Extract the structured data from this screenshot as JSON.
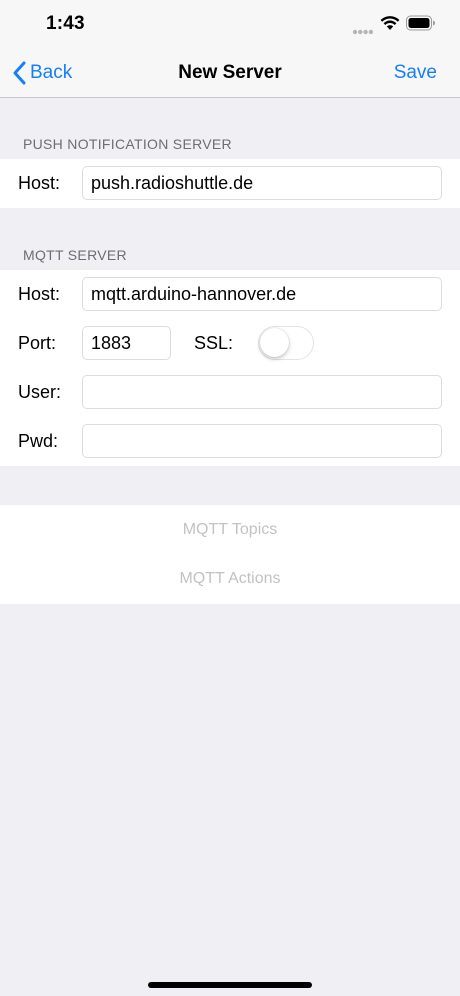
{
  "status": {
    "time": "1:43",
    "icons": [
      "signal-icon",
      "wifi-icon",
      "battery-icon"
    ]
  },
  "nav": {
    "back_label": "Back",
    "title": "New Server",
    "save_label": "Save",
    "accent_color": "#157efb"
  },
  "push_section": {
    "header": "PUSH NOTIFICATION SERVER",
    "host_label": "Host:",
    "host_value": "push.radioshuttle.de"
  },
  "mqtt_section": {
    "header": "MQTT SERVER",
    "host_label": "Host:",
    "host_value": "mqtt.arduino-hannover.de",
    "port_label": "Port:",
    "port_value": "1883",
    "ssl_label": "SSL:",
    "ssl_enabled": false,
    "user_label": "User:",
    "user_value": "",
    "pwd_label": "Pwd:",
    "pwd_value": ""
  },
  "actions": {
    "topics_label": "MQTT Topics",
    "actions_label": "MQTT Actions"
  }
}
